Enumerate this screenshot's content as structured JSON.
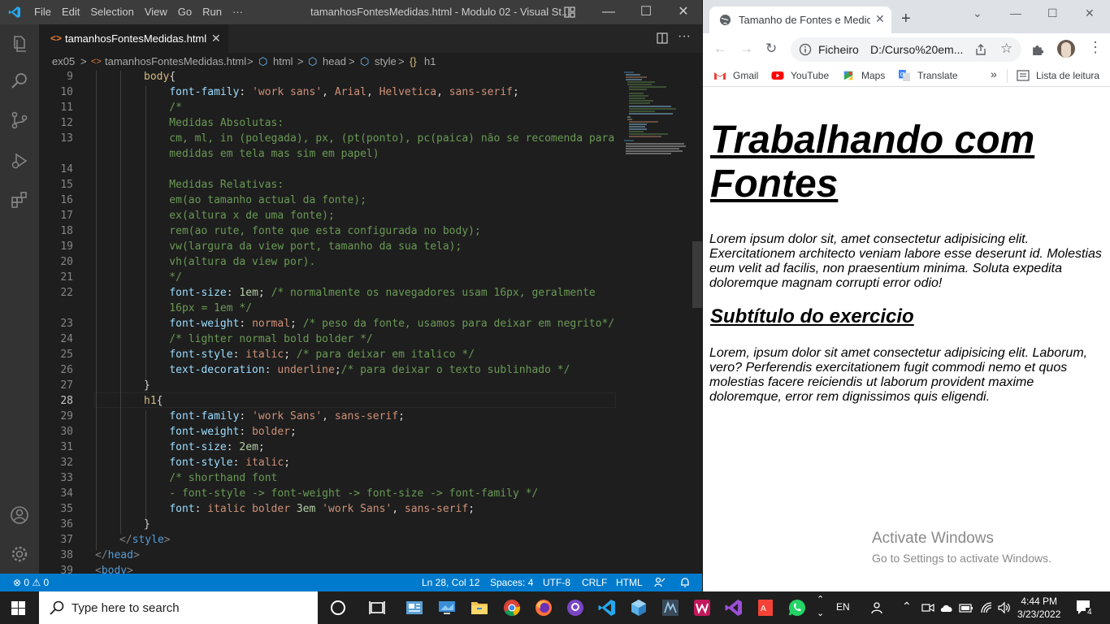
{
  "vscode": {
    "menu": [
      "File",
      "Edit",
      "Selection",
      "View",
      "Go",
      "Run",
      "···"
    ],
    "window_title": "tamanhosFontesMedidas.html - Modulo 02 - Visual St...",
    "controls": {
      "minimize": "—",
      "maximize": "☐",
      "close": "✕"
    },
    "tab": {
      "icon": "<>",
      "label": "tamanhosFontesMedidas.html",
      "close": "✕"
    },
    "tabs_more": "···",
    "breadcrumb": [
      "ex05",
      ">",
      "tamanhosFontesMedidas.html",
      ">",
      "html",
      ">",
      "head",
      ">",
      "style",
      ">",
      "h1"
    ],
    "lines": [
      {
        "n": "9",
        "parts": [
          [
            "kw",
            "body"
          ],
          [
            "t",
            "{"
          ]
        ]
      },
      {
        "n": "10",
        "parts": [
          [
            "t",
            "    "
          ],
          [
            "prop",
            "font-family"
          ],
          [
            "t",
            ": "
          ],
          [
            "str",
            "'work sans'"
          ],
          [
            "t",
            ", "
          ],
          [
            "str",
            "Arial"
          ],
          [
            "t",
            ", "
          ],
          [
            "str",
            "Helvetica"
          ],
          [
            "t",
            ", "
          ],
          [
            "str",
            "sans-serif"
          ],
          [
            "t",
            ";"
          ]
        ]
      },
      {
        "n": "11",
        "parts": [
          [
            "cm",
            "    /*"
          ]
        ]
      },
      {
        "n": "12",
        "parts": [
          [
            "cm",
            "    Medidas Absolutas:"
          ]
        ]
      },
      {
        "n": "13",
        "parts": [
          [
            "cm",
            "    cm, ml, in (polegada), px, (pt(ponto), pc(paica) não se recomenda para"
          ]
        ]
      },
      {
        "n": "",
        "parts": [
          [
            "cm",
            "    medidas em tela mas sim em papel)"
          ]
        ]
      },
      {
        "n": "14",
        "parts": [
          [
            "cm",
            ""
          ]
        ]
      },
      {
        "n": "15",
        "parts": [
          [
            "cm",
            "    Medidas Relativas:"
          ]
        ]
      },
      {
        "n": "16",
        "parts": [
          [
            "cm",
            "    em(ao tamanho actual da fonte);"
          ]
        ]
      },
      {
        "n": "17",
        "parts": [
          [
            "cm",
            "    ex(altura x de uma fonte);"
          ]
        ]
      },
      {
        "n": "18",
        "parts": [
          [
            "cm",
            "    rem(ao rute, fonte que esta configurada no body);"
          ]
        ]
      },
      {
        "n": "19",
        "parts": [
          [
            "cm",
            "    vw(largura da view port, tamanho da sua tela);"
          ]
        ]
      },
      {
        "n": "20",
        "parts": [
          [
            "cm",
            "    vh(altura da view por)."
          ]
        ]
      },
      {
        "n": "21",
        "parts": [
          [
            "cm",
            "    */"
          ]
        ]
      },
      {
        "n": "22",
        "parts": [
          [
            "t",
            "    "
          ],
          [
            "prop",
            "font-size"
          ],
          [
            "t",
            ": "
          ],
          [
            "num",
            "1em"
          ],
          [
            "t",
            "; "
          ],
          [
            "cm",
            "/* normalmente os navegadores usam 16px, geralmente"
          ]
        ]
      },
      {
        "n": "",
        "parts": [
          [
            "cm",
            "    16px = 1em */"
          ]
        ]
      },
      {
        "n": "23",
        "parts": [
          [
            "t",
            "    "
          ],
          [
            "prop",
            "font-weight"
          ],
          [
            "t",
            ": "
          ],
          [
            "str",
            "normal"
          ],
          [
            "t",
            "; "
          ],
          [
            "cm",
            "/* peso da fonte, usamos para deixar em negrito*/"
          ]
        ]
      },
      {
        "n": "24",
        "parts": [
          [
            "cm",
            "    /* lighter normal bold bolder */"
          ]
        ]
      },
      {
        "n": "25",
        "parts": [
          [
            "t",
            "    "
          ],
          [
            "prop",
            "font-style"
          ],
          [
            "t",
            ": "
          ],
          [
            "str",
            "italic"
          ],
          [
            "t",
            "; "
          ],
          [
            "cm",
            "/* para deixar em italico */"
          ]
        ]
      },
      {
        "n": "26",
        "parts": [
          [
            "t",
            "    "
          ],
          [
            "prop",
            "text-decoration"
          ],
          [
            "t",
            ": "
          ],
          [
            "str",
            "underline"
          ],
          [
            "t",
            ";"
          ],
          [
            "cm",
            "/* para deixar o texto sublinhado */"
          ]
        ]
      },
      {
        "n": "27",
        "parts": [
          [
            "t",
            "}"
          ]
        ]
      },
      {
        "n": "28",
        "parts": [
          [
            "kw",
            "h1"
          ],
          [
            "t",
            "{"
          ]
        ],
        "current": true
      },
      {
        "n": "29",
        "parts": [
          [
            "t",
            "    "
          ],
          [
            "prop",
            "font-family"
          ],
          [
            "t",
            ": "
          ],
          [
            "str",
            "'work Sans'"
          ],
          [
            "t",
            ", "
          ],
          [
            "str",
            "sans-serif"
          ],
          [
            "t",
            ";"
          ]
        ]
      },
      {
        "n": "30",
        "parts": [
          [
            "t",
            "    "
          ],
          [
            "prop",
            "font-weight"
          ],
          [
            "t",
            ": "
          ],
          [
            "str",
            "bolder"
          ],
          [
            "t",
            ";"
          ]
        ]
      },
      {
        "n": "31",
        "parts": [
          [
            "t",
            "    "
          ],
          [
            "prop",
            "font-size"
          ],
          [
            "t",
            ": "
          ],
          [
            "num",
            "2em"
          ],
          [
            "t",
            ";"
          ]
        ]
      },
      {
        "n": "32",
        "parts": [
          [
            "t",
            "    "
          ],
          [
            "prop",
            "font-style"
          ],
          [
            "t",
            ": "
          ],
          [
            "str",
            "italic"
          ],
          [
            "t",
            ";"
          ]
        ]
      },
      {
        "n": "33",
        "parts": [
          [
            "cm",
            "    /* shorthand font"
          ]
        ]
      },
      {
        "n": "34",
        "parts": [
          [
            "cm",
            "    - font-style -> font-weight -> font-size -> font-family */"
          ]
        ]
      },
      {
        "n": "35",
        "parts": [
          [
            "t",
            "    "
          ],
          [
            "prop",
            "font"
          ],
          [
            "t",
            ": "
          ],
          [
            "str",
            "italic bolder "
          ],
          [
            "num",
            "3em"
          ],
          [
            "t",
            " "
          ],
          [
            "str",
            "'work Sans'"
          ],
          [
            "t",
            ", "
          ],
          [
            "str",
            "sans-serif"
          ],
          [
            "t",
            ";"
          ]
        ]
      },
      {
        "n": "36",
        "parts": [
          [
            "t",
            "}"
          ]
        ]
      },
      {
        "n": "37",
        "parts": [
          [
            "punc",
            "</"
          ],
          [
            "tag",
            "style"
          ],
          [
            "punc",
            ">"
          ]
        ],
        "indent": -1
      },
      {
        "n": "38",
        "parts": [
          [
            "punc",
            "</"
          ],
          [
            "tag",
            "head"
          ],
          [
            "punc",
            ">"
          ]
        ],
        "indent": -2
      },
      {
        "n": "39",
        "parts": [
          [
            "punc",
            "<"
          ],
          [
            "tag",
            "body"
          ],
          [
            "punc",
            ">"
          ]
        ],
        "indent": -2
      }
    ],
    "status": {
      "problems": "⊗ 0 ⚠ 0",
      "position": "Ln 28, Col 12",
      "spaces": "Spaces: 4",
      "encoding": "UTF-8",
      "eol": "CRLF",
      "language": "HTML"
    }
  },
  "chrome": {
    "tab_title": "Tamanho de Fontes e Medida",
    "tab_close": "✕",
    "new_tab": "+",
    "controls": {
      "dropdown": "⌄",
      "minimize": "—",
      "maximize": "☐",
      "close": "✕"
    },
    "nav": {
      "back": "←",
      "forward": "→",
      "reload": "↻"
    },
    "omnibox": {
      "scheme": "Ficheiro",
      "url": "D:/Curso%20em..."
    },
    "bookmarks": [
      "Gmail",
      "YouTube",
      "Maps",
      "Translate"
    ],
    "bookmarks_more": "»",
    "reading_list": "Lista de leitura",
    "page": {
      "h1": "Trabalhando com Fontes",
      "p1": "Lorem ipsum dolor sit, amet consectetur adipisicing elit. Exercitationem architecto veniam labore esse deserunt id. Molestias eum velit ad facilis, non praesentium minima. Soluta expedita doloremque magnam corrupti error odio!",
      "h2": "Subtítulo do exercicio",
      "p2": "Lorem, ipsum dolor sit amet consectetur adipisicing elit. Laborum, vero? Perferendis exercitationem fugit commodi nemo et quos molestias facere reiciendis ut laborum provident maxime doloremque, error rem dignissimos quis eligendi."
    },
    "activate": {
      "title": "Activate Windows",
      "subtitle": "Go to Settings to activate Windows."
    }
  },
  "taskbar": {
    "search_placeholder": "Type here to search",
    "lang": "EN",
    "time": "4:44 PM",
    "date": "3/23/2022",
    "notifications": "4"
  },
  "colors": {
    "vscode_accent": "#007acc",
    "taskbar": "#1f1f1f",
    "chrome_tabstrip": "#dee1e6"
  }
}
